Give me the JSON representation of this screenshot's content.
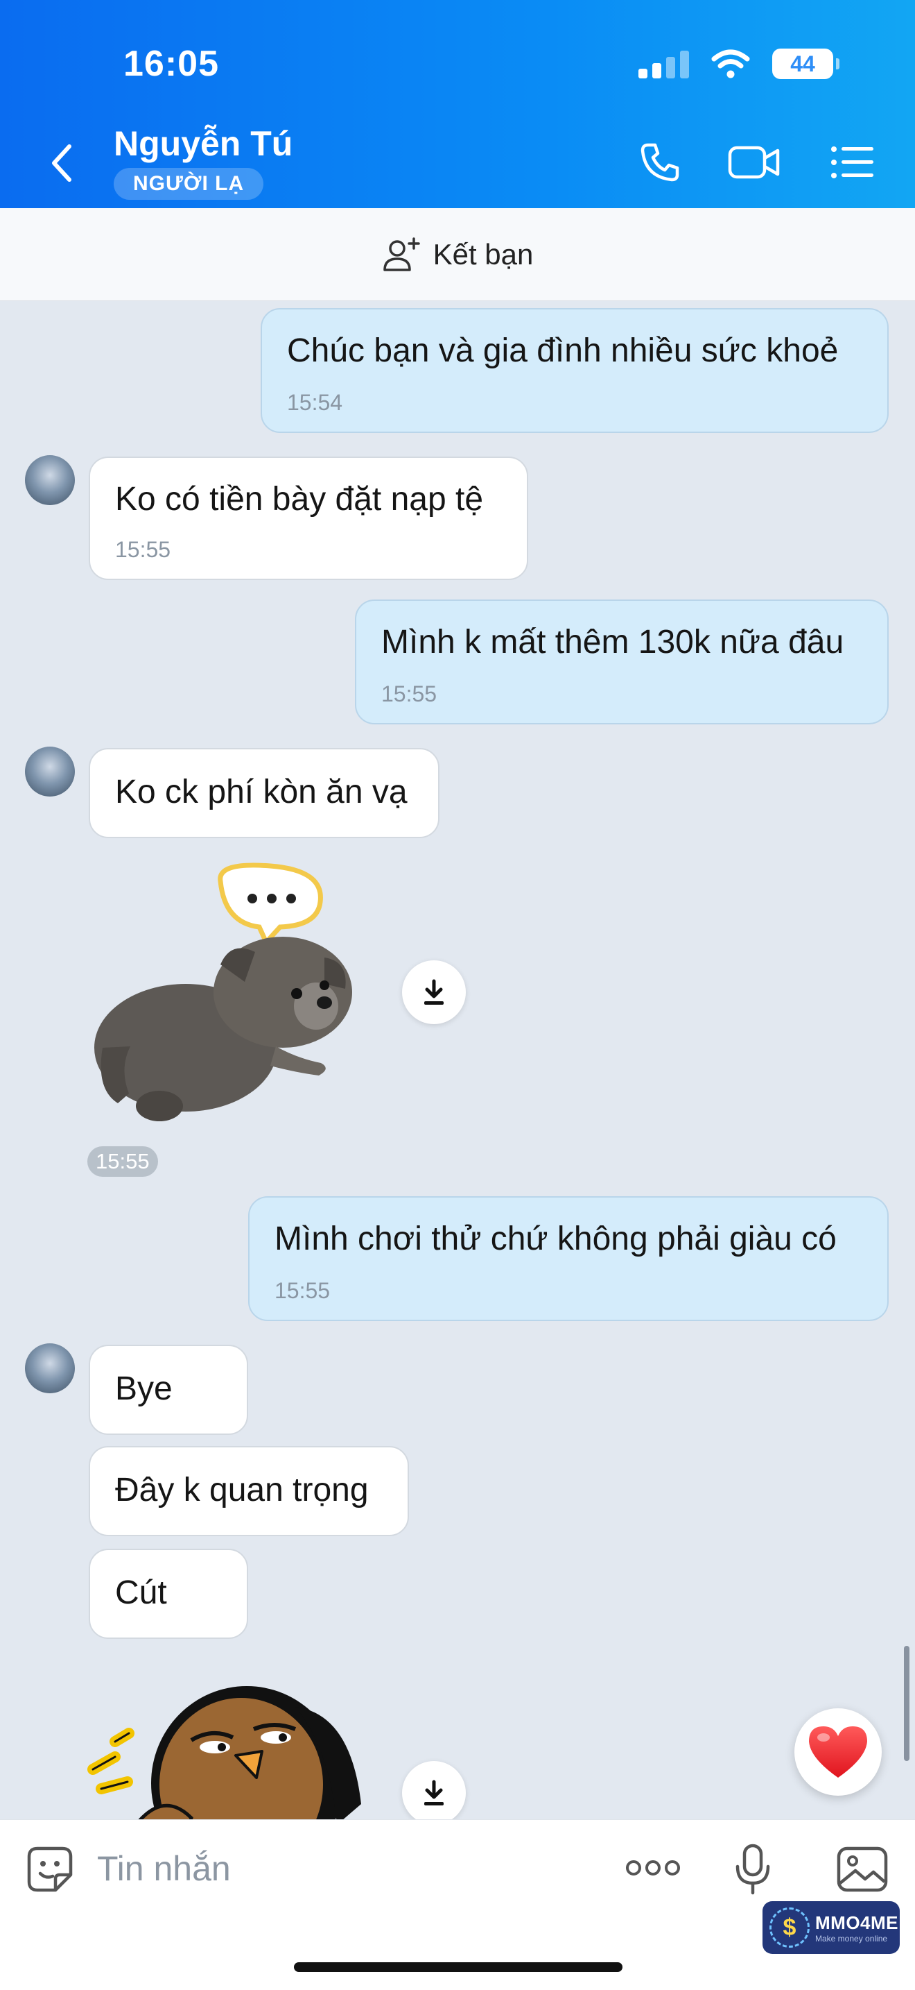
{
  "status_bar": {
    "time": "16:05",
    "battery": "44"
  },
  "header": {
    "contact_name": "Nguyễn Tú",
    "badge": "NGƯỜI LẠ"
  },
  "friend_bar": {
    "label": "Kết bạn"
  },
  "messages": [
    {
      "from": "me",
      "text": "Chúc bạn và gia đình nhiều sức khoẻ",
      "time": "15:54"
    },
    {
      "from": "them",
      "text": "Ko có tiền bày đặt nạp tệ",
      "time": "15:55"
    },
    {
      "from": "me",
      "text": "Mình k mất thêm 130k nữa đâu",
      "time": "15:55"
    },
    {
      "from": "them",
      "text": "Ko ck phí kòn ăn vạ"
    },
    {
      "from": "them",
      "type": "sticker",
      "time": "15:55"
    },
    {
      "from": "me",
      "text": "Mình chơi thử chứ không phải giàu có",
      "time": "15:55"
    },
    {
      "from": "them",
      "text": "Bye"
    },
    {
      "from": "them",
      "text": "Đây k quan trọng"
    },
    {
      "from": "them",
      "text": "Cút"
    },
    {
      "from": "them",
      "type": "sticker"
    }
  ],
  "input": {
    "placeholder": "Tin nhắn"
  },
  "watermark": {
    "title": "MMO4ME",
    "subtitle": "Make money online"
  },
  "colors": {
    "header_start": "#0a6cf0",
    "header_end": "#12a6f3",
    "my_bubble": "#d4ecfb",
    "their_bubble": "#ffffff",
    "chat_bg": "#e2e8f0"
  }
}
